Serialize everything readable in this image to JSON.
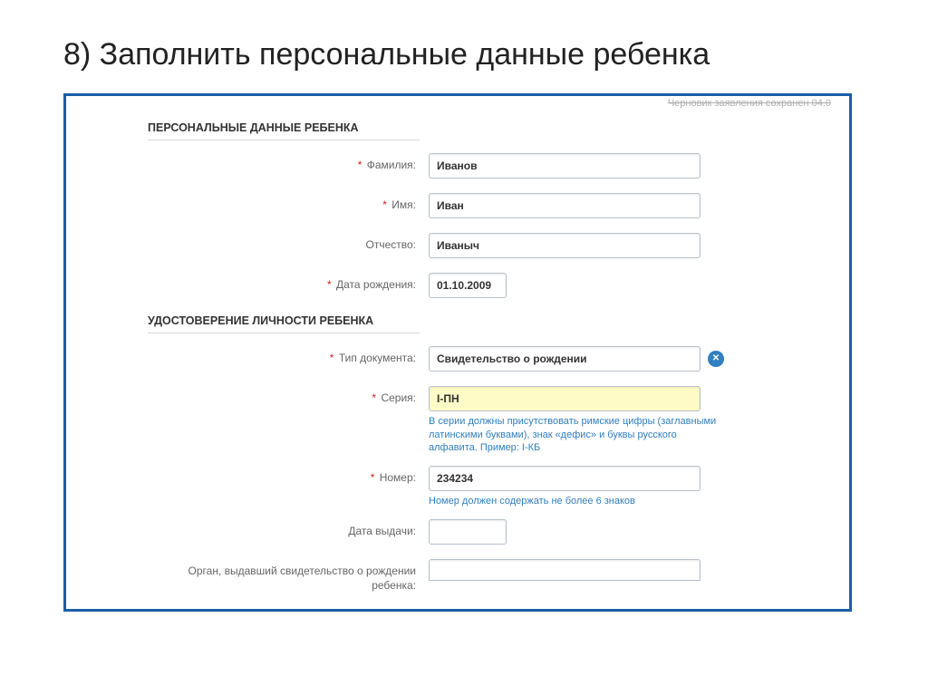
{
  "slide": {
    "title": "8) Заполнить персональные данные ребенка"
  },
  "draft_note": "Черновик заявления сохранен 04.0",
  "section1": {
    "heading": "ПЕРСОНАЛЬНЫЕ ДАННЫЕ РЕБЕНКА",
    "surname": {
      "label": "Фамилия:",
      "value": "Иванов",
      "required": true
    },
    "name": {
      "label": "Имя:",
      "value": "Иван",
      "required": true
    },
    "patronymic": {
      "label": "Отчество:",
      "value": "Иваныч",
      "required": false
    },
    "dob": {
      "label": "Дата рождения:",
      "value": "01.10.2009",
      "required": true
    }
  },
  "section2": {
    "heading": "УДОСТОВЕРЕНИЕ ЛИЧНОСТИ РЕБЕНКА",
    "doc_type": {
      "label": "Тип документа:",
      "value": "Свидетельство о рождении",
      "required": true
    },
    "series": {
      "label": "Серия:",
      "value": "I-ПН",
      "required": true,
      "hint": "В серии должны присутствовать римские цифры (заглавными латинскими буквами), знак «дефис» и буквы русского алфавита. Пример: I-КБ"
    },
    "number": {
      "label": "Номер:",
      "value": "234234",
      "required": true,
      "hint": "Номер должен содержать не более 6 знаков"
    },
    "issue_date": {
      "label": "Дата выдачи:",
      "value": "",
      "required": false
    },
    "issuer": {
      "label": "Орган, выдавший свидетельство о рождении ребенка:",
      "value": "",
      "required": false
    }
  }
}
